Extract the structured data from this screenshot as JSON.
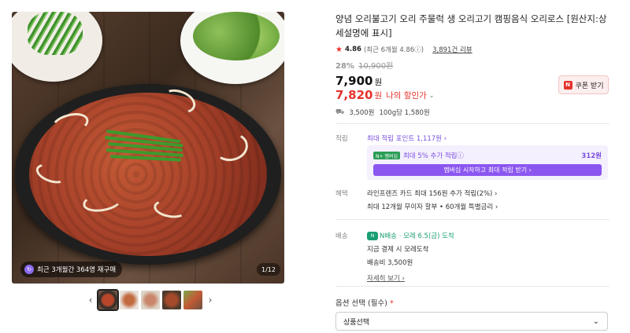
{
  "gallery": {
    "badge_text": "최근 3개월간 364명 재구매",
    "counter": "1/12",
    "prev_arrow": "‹",
    "next_arrow": "›"
  },
  "product": {
    "title": "양념 오리불고기 오리 주물럭 생 오리고기 캠핑음식 오리로스 [원산지:상세설명에 표시]",
    "rating": "4.86",
    "rating_detail": "(최근 6개월 4.86ⓘ)",
    "reviews": "3,891건 리뷰",
    "discount_rate": "28%",
    "original_price": "10,900원",
    "price": "7,900",
    "price_unit": "원",
    "my_price": "7,820",
    "my_price_unit": "원",
    "my_price_label": "나의 할인가",
    "coupon_label": "쿠폰 받기",
    "shipping_fee": "3,500원",
    "unit_price": "100g당 1,580원"
  },
  "points": {
    "label": "적립",
    "max_points": "최대 적립 포인트 1,117원 ›",
    "benefit_text": "최대 5% 추가 적립ⓘ",
    "benefit_points": "312원",
    "membership_button": "멤버십 시작하고 최대 적립 받기 ›",
    "tag_text": "N+ 멤버십"
  },
  "benefits": {
    "label": "혜택",
    "line1": "라인프렌즈 카드 최대 156원 추가 적립(2%) ›",
    "line2": "최대 12개월 무이자 할부 • 60개월 특별금리 ›"
  },
  "delivery": {
    "label": "배송",
    "arrival": "모레 6.5(금) 도착",
    "service": "N배송",
    "payment_note": "지금 결제 시 모레도착",
    "fee": "배송비 3,500원",
    "details_link": "자세히 보기 ›"
  },
  "options": {
    "label": "옵션 선택 (필수)",
    "required_mark": "*",
    "select_value": "상품선택"
  }
}
